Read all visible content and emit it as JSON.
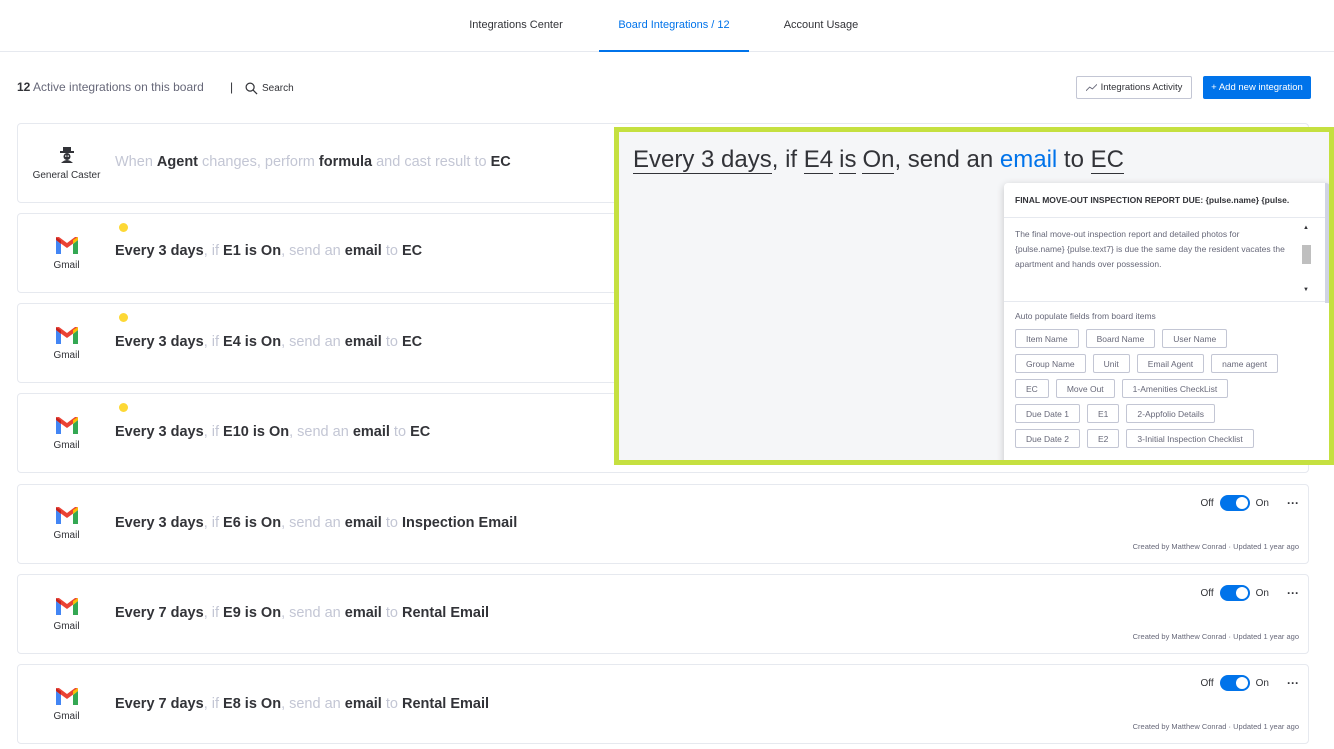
{
  "tabs": [
    {
      "label": "Integrations Center"
    },
    {
      "label": "Board Integrations / 12"
    },
    {
      "label": "Account Usage"
    }
  ],
  "toolbar": {
    "active_count": "12",
    "active_text": "Active integrations on this board",
    "separator": "|",
    "search_label": "Search",
    "activity_label": "Integrations Activity",
    "add_label": "+ Add new integration"
  },
  "rows": [
    {
      "logo_label": "General Caster",
      "parts": [
        "When ",
        "Agent",
        " changes, perform ",
        "formula",
        " and cast result to ",
        "EC"
      ]
    },
    {
      "logo_label": "Gmail",
      "parts": [
        "Every 3 days",
        ", if ",
        "E1 is On",
        ", send an ",
        "email",
        " to ",
        "EC"
      ]
    },
    {
      "logo_label": "Gmail",
      "parts": [
        "Every 3 days",
        ", if ",
        "E4 is On",
        ", send an ",
        "email",
        " to ",
        "EC"
      ]
    },
    {
      "logo_label": "Gmail",
      "parts": [
        "Every 3 days",
        ", if ",
        "E10 is On",
        ", send an ",
        "email",
        " to ",
        "EC"
      ]
    },
    {
      "logo_label": "Gmail",
      "parts": [
        "Every 3 days",
        ", if ",
        "E6 is On",
        ", send an ",
        "email",
        " to ",
        "Inspection Email"
      ],
      "toggle_off": "Off",
      "toggle_on": "On",
      "more": "···",
      "created": "Created by Matthew Conrad · Updated 1 year ago"
    },
    {
      "logo_label": "Gmail",
      "parts": [
        "Every 7 days",
        ", if ",
        "E9 is On",
        ", send an ",
        "email",
        " to ",
        "Rental Email"
      ],
      "toggle_off": "Off",
      "toggle_on": "On",
      "more": "···",
      "created": "Created by Matthew Conrad · Updated 1 year ago"
    },
    {
      "logo_label": "Gmail",
      "parts": [
        "Every 7 days",
        ", if ",
        "E8 is On",
        ", send an ",
        "email",
        " to ",
        "Rental Email"
      ],
      "toggle_off": "Off",
      "toggle_on": "On",
      "more": "···",
      "created": "Created by Matthew Conrad · Updated 1 year ago"
    }
  ],
  "overlay": {
    "sentence": {
      "every": "Every 3 days",
      "if": ", if ",
      "field": "E4",
      "is": "is",
      "value": "On",
      "send": ", send an ",
      "email": "email",
      "to": " to ",
      "target": "EC"
    },
    "card_title": "FINAL MOVE-OUT INSPECTION REPORT DUE: {pulse.name}  {pulse.",
    "card_body": "The final move-out inspection report and detailed photos for {pulse.name}  {pulse.text7} is due the same day the resident vacates the apartment and hands over possession.",
    "auto_label": "Auto populate fields from board items",
    "chips": [
      [
        "Item Name",
        "Board Name",
        "User Name"
      ],
      [
        "Group Name",
        "Unit",
        "Email Agent",
        "name agent"
      ],
      [
        "EC",
        "Move Out",
        "1-Amenities CheckList"
      ],
      [
        "Due Date 1",
        "E1",
        "2-Appfolio Details"
      ],
      [
        "Due Date 2",
        "E2",
        "3-Initial Inspection Checklist"
      ]
    ]
  },
  "colors": {
    "accent": "#0073ea",
    "highlight": "#c5e040",
    "status_dot": "#fdd835"
  }
}
